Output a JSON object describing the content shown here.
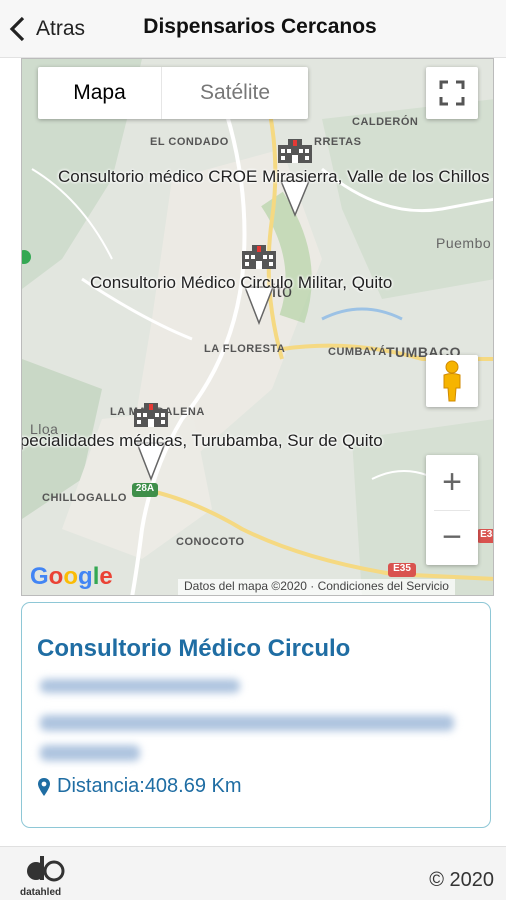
{
  "header": {
    "back_label": "Atras",
    "title": "Dispensarios Cercanos"
  },
  "map": {
    "type_map_label": "Mapa",
    "type_satellite_label": "Satélite",
    "places": [
      "CALDERÓN",
      "EL CONDADO",
      "RRETAS",
      "Puembo",
      "LA FLORESTA",
      "CUMBAYÁ",
      "TUMBACO",
      "Lloa",
      "LA MAGDALENA",
      "CHILLOGALLO",
      "CONOCOTO",
      "ito"
    ],
    "road_shields": [
      "28A",
      "E35",
      "E35"
    ],
    "markers": [
      {
        "label": "Consultorio médico CROE Mirasierra, Valle de los Chillos"
      },
      {
        "label": "Consultorio Médico Circulo Militar, Quito"
      },
      {
        "label": "Especialidades médicas, Turubamba, Sur de Quito"
      }
    ],
    "google_logo": "Google",
    "attribution": "Datos del mapa ©2020 · Condiciones del Servicio"
  },
  "card": {
    "title": "Consultorio Médico Circulo",
    "distance": "Distancia:408.69 Km"
  },
  "footer": {
    "copyright": "© 2020",
    "logo_text": "datahled"
  },
  "colors": {
    "accent": "#1f6da3",
    "card_border": "#8ec7d6"
  }
}
